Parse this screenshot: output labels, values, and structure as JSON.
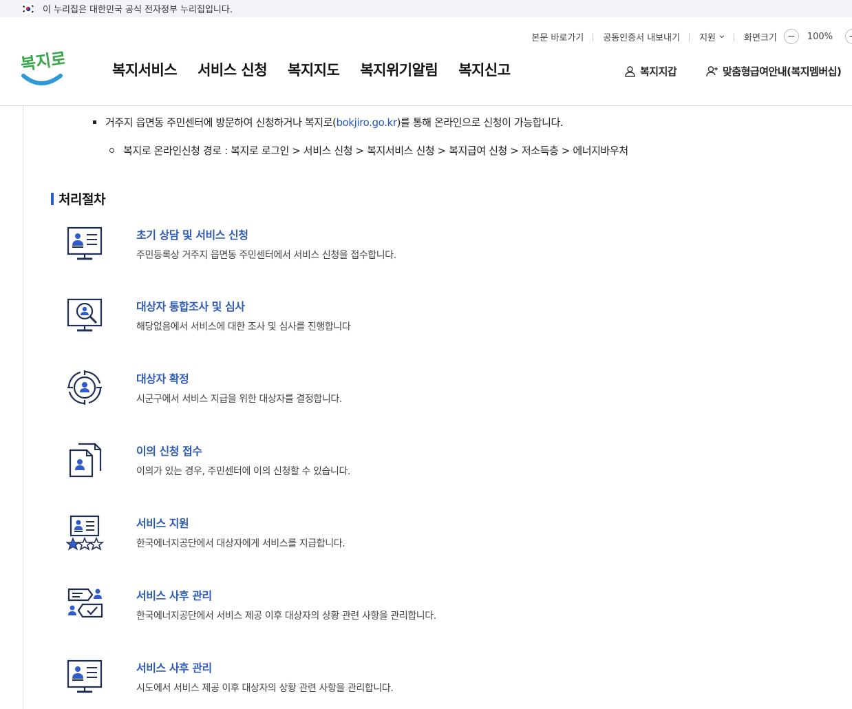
{
  "gov_banner": {
    "text": "이 누리집은 대한민국 공식 전자정부 누리집입니다."
  },
  "utility": {
    "skip_label": "본문 바로가기",
    "cert_label": "공동인증서 내보내기",
    "support_label": "지원",
    "screen_size_label": "화면크기",
    "zoom_out": "−",
    "zoom_value": "100%",
    "zoom_in": "+"
  },
  "logo": {
    "text": "복지로"
  },
  "nav": {
    "items": [
      "복지서비스",
      "서비스 신청",
      "복지지도",
      "복지위기알림",
      "복지신고"
    ]
  },
  "quick": {
    "wallet": "복지지갑",
    "membership": "맞춤형급여안내(복지멤버십)"
  },
  "content": {
    "bullet_before": "거주지 읍면동 주민센터에 방문하여 신청하거나 복지로(",
    "bullet_link": "bokjiro.go.kr",
    "bullet_after": ")를 통해 온라인으로 신청이 가능합니다.",
    "sub_bullet": "복지로 온라인신청 경로 : 복지로 로그인 > 서비스 신청 > 복지서비스 신청 > 복지급여 신청 > 저소득층 > 에너지바우처"
  },
  "process": {
    "title": "처리절차",
    "steps": [
      {
        "icon": "applicant-profile-monitor-icon",
        "title": "초기 상담 및 서비스 신청",
        "desc": "주민등록상 거주지 읍면동 주민센터에서 서비스 신청을 접수합니다."
      },
      {
        "icon": "search-person-monitor-icon",
        "title": "대상자 통합조사 및 심사",
        "desc": "해당없음에서 서비스에 대한 조사 및 심사를 진행합니다"
      },
      {
        "icon": "target-person-icon",
        "title": "대상자 확정",
        "desc": "시군구에서 서비스 지급을 위한 대상자를 결정합니다."
      },
      {
        "icon": "person-documents-icon",
        "title": "이의 신청 접수",
        "desc": "이의가 있는 경우, 주민센터에 이의 신청할 수 있습니다."
      },
      {
        "icon": "profile-stars-icon",
        "title": "서비스 지원",
        "desc": "한국에너지공단에서 대상자에게 서비스를 지급합니다."
      },
      {
        "icon": "chat-people-check-icon",
        "title": "서비스 사후 관리",
        "desc": "한국에너지공단에서 서비스 제공 이후 대상자의 상황 관련 사항을 관리합니다."
      },
      {
        "icon": "applicant-profile-monitor-icon",
        "title": "서비스 사후 관리",
        "desc": "시도에서 서비스 제공 이후 대상자의 상황 관련 사항을 관리합니다."
      }
    ]
  }
}
